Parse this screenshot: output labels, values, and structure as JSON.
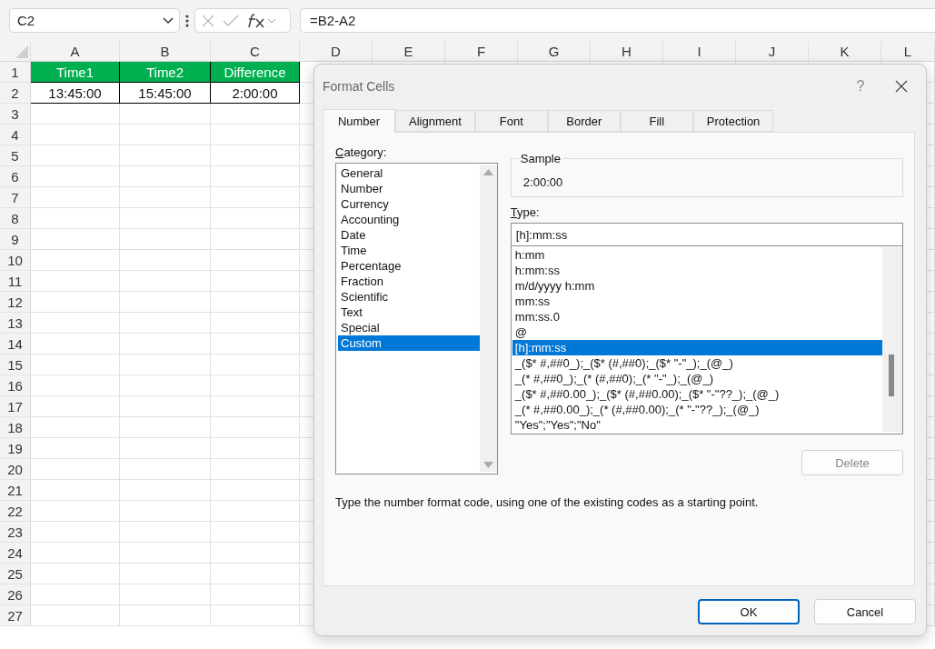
{
  "name_box": {
    "value": "C2"
  },
  "formula_bar": {
    "value": "=B2-A2"
  },
  "sheet": {
    "columns": [
      "A",
      "B",
      "C",
      "D",
      "E",
      "F",
      "G",
      "H",
      "I",
      "J",
      "K",
      "L"
    ],
    "rows": [
      {
        "label": "1",
        "cells": [
          {
            "text": "Time1",
            "kind": "header"
          },
          {
            "text": "Time2",
            "kind": "header"
          },
          {
            "text": "Difference",
            "kind": "header"
          }
        ]
      },
      {
        "label": "2",
        "cells": [
          {
            "text": "13:45:00",
            "kind": "value"
          },
          {
            "text": "15:45:00",
            "kind": "value"
          },
          {
            "text": "2:00:00",
            "kind": "value"
          }
        ]
      },
      {
        "label": "3"
      },
      {
        "label": "4"
      },
      {
        "label": "5"
      },
      {
        "label": "6"
      },
      {
        "label": "7"
      },
      {
        "label": "8"
      },
      {
        "label": "9"
      },
      {
        "label": "10"
      },
      {
        "label": "11"
      },
      {
        "label": "12"
      },
      {
        "label": "13"
      },
      {
        "label": "14"
      },
      {
        "label": "15"
      },
      {
        "label": "16"
      },
      {
        "label": "17"
      },
      {
        "label": "18"
      },
      {
        "label": "19"
      },
      {
        "label": "20"
      },
      {
        "label": "21"
      },
      {
        "label": "22"
      },
      {
        "label": "23"
      },
      {
        "label": "24"
      },
      {
        "label": "25"
      },
      {
        "label": "26"
      },
      {
        "label": "27"
      }
    ]
  },
  "dialog": {
    "title": "Format Cells",
    "help": "?",
    "tabs": [
      {
        "label": "Number",
        "selected": true
      },
      {
        "label": "Alignment",
        "selected": false
      },
      {
        "label": "Font",
        "selected": false
      },
      {
        "label": "Border",
        "selected": false
      },
      {
        "label": "Fill",
        "selected": false
      },
      {
        "label": "Protection",
        "selected": false
      }
    ],
    "category": {
      "label": "Category:",
      "items": [
        {
          "label": "General",
          "selected": false
        },
        {
          "label": "Number",
          "selected": false
        },
        {
          "label": "Currency",
          "selected": false
        },
        {
          "label": "Accounting",
          "selected": false
        },
        {
          "label": "Date",
          "selected": false
        },
        {
          "label": "Time",
          "selected": false
        },
        {
          "label": "Percentage",
          "selected": false
        },
        {
          "label": "Fraction",
          "selected": false
        },
        {
          "label": "Scientific",
          "selected": false
        },
        {
          "label": "Text",
          "selected": false
        },
        {
          "label": "Special",
          "selected": false
        },
        {
          "label": "Custom",
          "selected": true
        }
      ]
    },
    "sample": {
      "label": "Sample",
      "value": "2:00:00"
    },
    "type": {
      "label": "Type:",
      "value": "[h]:mm:ss",
      "items": [
        {
          "label": "h:mm",
          "selected": false
        },
        {
          "label": "h:mm:ss",
          "selected": false
        },
        {
          "label": "m/d/yyyy h:mm",
          "selected": false
        },
        {
          "label": "mm:ss",
          "selected": false
        },
        {
          "label": "mm:ss.0",
          "selected": false
        },
        {
          "label": "@",
          "selected": false
        },
        {
          "label": "[h]:mm:ss",
          "selected": true
        },
        {
          "label": "_($* #,##0_);_($* (#,##0);_($* \"-\"_);_(@_)",
          "selected": false
        },
        {
          "label": "_(* #,##0_);_(* (#,##0);_(* \"-\"_);_(@_)",
          "selected": false
        },
        {
          "label": "_($* #,##0.00_);_($* (#,##0.00);_($* \"-\"??_);_(@_)",
          "selected": false
        },
        {
          "label": "_(* #,##0.00_);_(* (#,##0.00);_(* \"-\"??_);_(@_)",
          "selected": false
        },
        {
          "label": "\"Yes\";\"Yes\";\"No\"",
          "selected": false
        }
      ]
    },
    "delete_button": {
      "label": "Delete",
      "disabled": true
    },
    "description": "Type the number format code, using one of the existing codes as a starting point.",
    "buttons": [
      {
        "label": "OK",
        "kind": "primary"
      },
      {
        "label": "Cancel",
        "kind": "secondary"
      }
    ]
  }
}
